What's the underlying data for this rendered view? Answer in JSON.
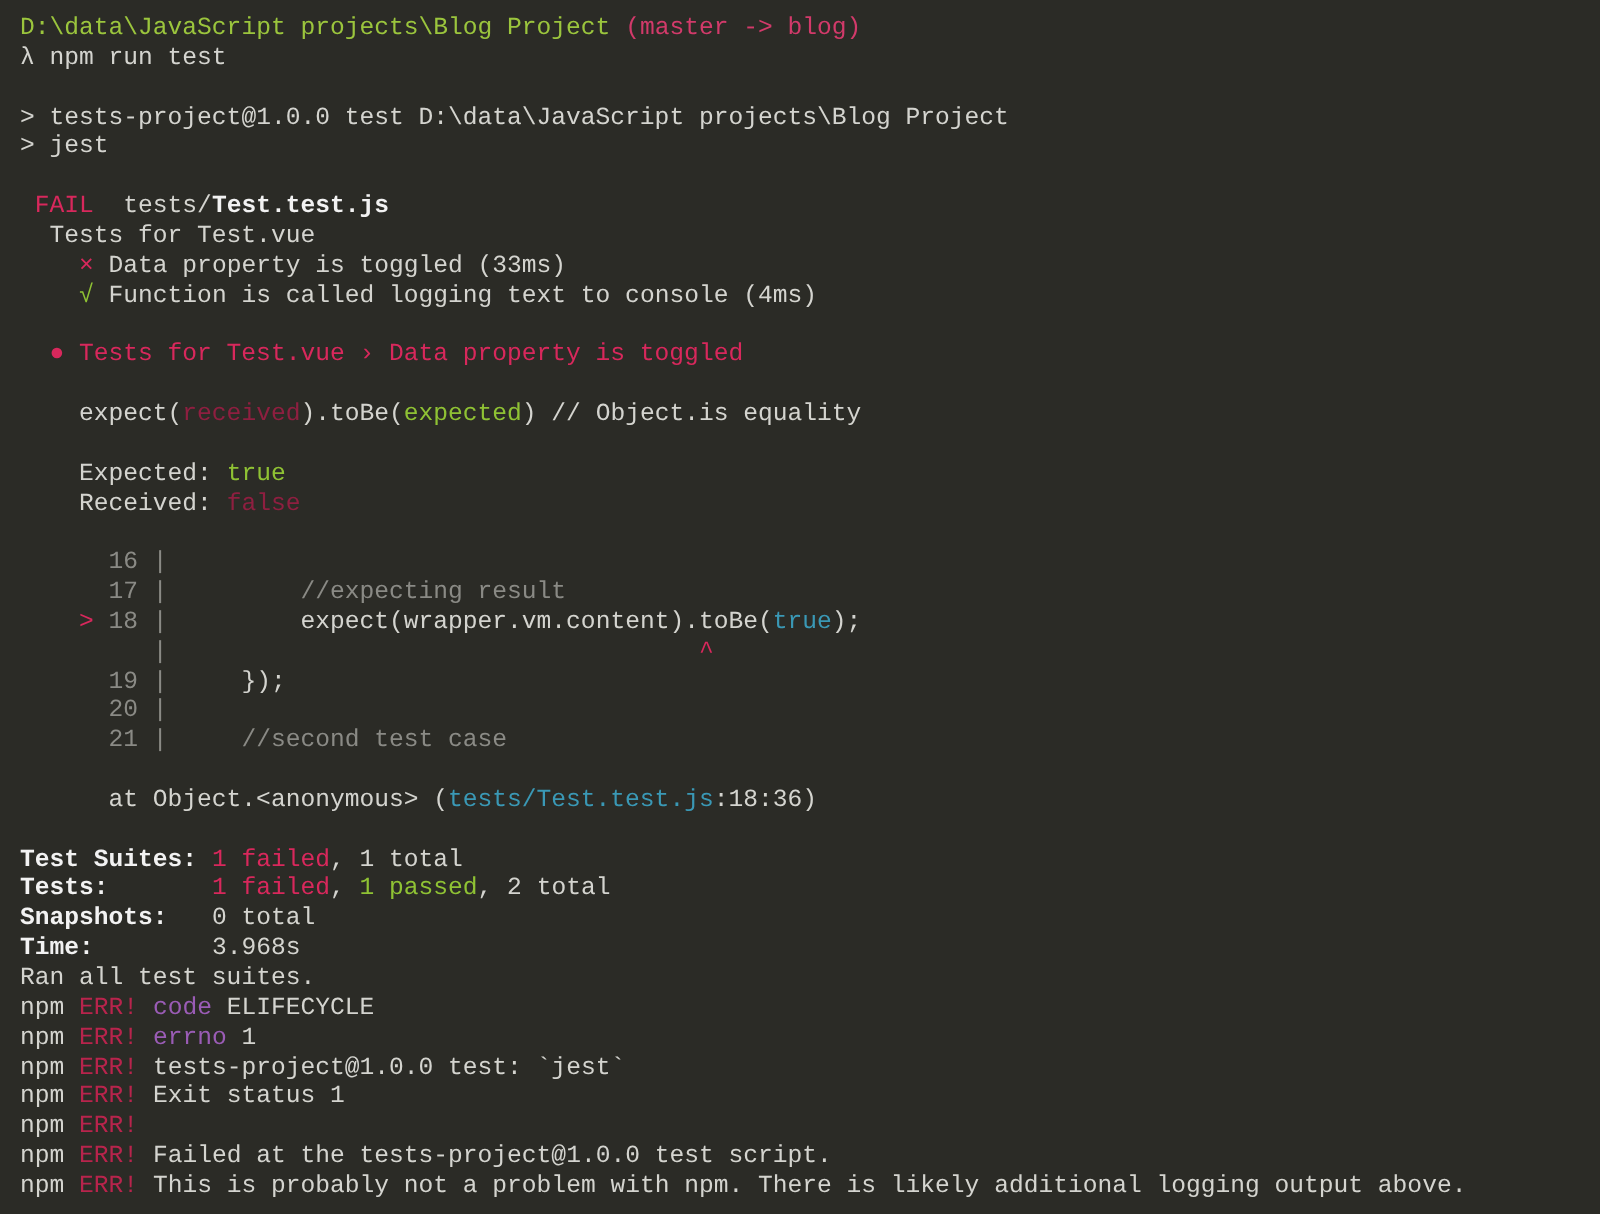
{
  "terminal": {
    "blocks": [
      {
        "lines": [
          {
            "kind": "root",
            "segments": [
              {
                "text": "D:\\data\\JavaScript projects\\Blog Project",
                "kind": "path"
              },
              {
                "text": " (master -> blog)",
                "kind": "branch"
              }
            ]
          },
          {
            "kind": "root",
            "segments": [
              {
                "text": "λ npm run test",
                "kind": "plain"
              }
            ]
          }
        ]
      },
      {
        "lines": [
          {
            "kind": "root",
            "segments": [
              {
                "text": "> tests-project@1.0.0 test D:\\data\\JavaScript projects\\Blog Project",
                "kind": "plain"
              }
            ]
          },
          {
            "kind": "root",
            "segments": [
              {
                "text": "> jest",
                "kind": "plain"
              }
            ]
          }
        ]
      },
      {
        "lines": [
          {
            "kind": "file",
            "segments": [
              {
                "text": "FAIL",
                "kind": "fail"
              },
              {
                "text": "  tests/",
                "kind": "plain"
              },
              {
                "text": "Test.test.js",
                "kind": "bold"
              }
            ]
          },
          {
            "kind": "suite",
            "segments": [
              {
                "text": "Tests for Test.vue",
                "kind": "plain"
              }
            ]
          },
          {
            "kind": "case",
            "segments": [
              {
                "text": "×",
                "kind": "fail"
              },
              {
                "text": " Data property is toggled (33ms)",
                "kind": "plain"
              }
            ]
          },
          {
            "kind": "case",
            "segments": [
              {
                "text": "√",
                "kind": "pass"
              },
              {
                "text": " Function is called logging text to console (4ms)",
                "kind": "plain"
              }
            ]
          }
        ]
      },
      {
        "lines": [
          {
            "kind": "suite",
            "segments": [
              {
                "text": "● Tests for Test.vue › Data property is toggled",
                "kind": "fail"
              }
            ]
          }
        ]
      },
      {
        "lines": [
          {
            "kind": "detail",
            "segments": [
              {
                "text": "expect(",
                "kind": "plain"
              },
              {
                "text": "received",
                "kind": "received"
              },
              {
                "text": ").toBe(",
                "kind": "plain"
              },
              {
                "text": "expected",
                "kind": "pass"
              },
              {
                "text": ") // Object.is equality",
                "kind": "plain"
              }
            ]
          }
        ]
      },
      {
        "lines": [
          {
            "kind": "detail",
            "segments": [
              {
                "text": "Expected: ",
                "kind": "plain"
              },
              {
                "text": "true",
                "kind": "pass"
              }
            ]
          },
          {
            "kind": "detail",
            "segments": [
              {
                "text": "Received: ",
                "kind": "plain"
              },
              {
                "text": "false",
                "kind": "received"
              }
            ]
          }
        ]
      },
      {
        "lines": [
          {
            "kind": "code",
            "segments": [
              {
                "text": "  16 |",
                "kind": "dim"
              }
            ]
          },
          {
            "kind": "code",
            "segments": [
              {
                "text": "  17 |",
                "kind": "dim"
              },
              {
                "text": "         //expecting result",
                "kind": "dim"
              }
            ]
          },
          {
            "kind": "code",
            "segments": [
              {
                "text": ">",
                "kind": "fail"
              },
              {
                "text": " 18 |",
                "kind": "dim"
              },
              {
                "text": "         expect(wrapper.vm.content).toBe(",
                "kind": "plain"
              },
              {
                "text": "true",
                "kind": "link"
              },
              {
                "text": ");",
                "kind": "plain"
              }
            ]
          },
          {
            "kind": "code",
            "segments": [
              {
                "text": "     |",
                "kind": "dim"
              },
              {
                "text": "                                    ^",
                "kind": "fail"
              }
            ]
          },
          {
            "kind": "code",
            "segments": [
              {
                "text": "  19 |",
                "kind": "dim"
              },
              {
                "text": "     });",
                "kind": "plain"
              }
            ]
          },
          {
            "kind": "code",
            "segments": [
              {
                "text": "  20 |",
                "kind": "dim"
              }
            ]
          },
          {
            "kind": "code",
            "segments": [
              {
                "text": "  21 |",
                "kind": "dim"
              },
              {
                "text": "     //second test case",
                "kind": "dim"
              }
            ]
          }
        ]
      },
      {
        "lines": [
          {
            "kind": "trace",
            "segments": [
              {
                "text": "at Object.<anonymous> (",
                "kind": "plain"
              },
              {
                "text": "tests/Test.test.js",
                "kind": "link"
              },
              {
                "text": ":18:36)",
                "kind": "plain"
              }
            ]
          }
        ]
      },
      {
        "lines": [
          {
            "kind": "root",
            "segments": [
              {
                "text": "Test Suites: ",
                "kind": "bold"
              },
              {
                "text": "1 failed",
                "kind": "fail"
              },
              {
                "text": ", 1 total",
                "kind": "plain"
              }
            ]
          },
          {
            "kind": "root",
            "segments": [
              {
                "text": "Tests:       ",
                "kind": "bold"
              },
              {
                "text": "1 failed",
                "kind": "fail"
              },
              {
                "text": ", ",
                "kind": "plain"
              },
              {
                "text": "1 passed",
                "kind": "pass"
              },
              {
                "text": ", 2 total",
                "kind": "plain"
              }
            ]
          },
          {
            "kind": "root",
            "segments": [
              {
                "text": "Snapshots:   ",
                "kind": "bold"
              },
              {
                "text": "0 total",
                "kind": "plain"
              }
            ]
          },
          {
            "kind": "root",
            "segments": [
              {
                "text": "Time:        ",
                "kind": "bold"
              },
              {
                "text": "3.968s",
                "kind": "plain"
              }
            ]
          },
          {
            "kind": "root",
            "segments": [
              {
                "text": "Ran all test suites.",
                "kind": "plain"
              }
            ]
          },
          {
            "kind": "root",
            "segments": [
              {
                "text": "npm ",
                "kind": "plain"
              },
              {
                "text": "ERR!",
                "kind": "err"
              },
              {
                "text": " code",
                "kind": "key"
              },
              {
                "text": " ELIFECYCLE",
                "kind": "plain"
              }
            ]
          },
          {
            "kind": "root",
            "segments": [
              {
                "text": "npm ",
                "kind": "plain"
              },
              {
                "text": "ERR!",
                "kind": "err"
              },
              {
                "text": " errno",
                "kind": "key"
              },
              {
                "text": " 1",
                "kind": "plain"
              }
            ]
          },
          {
            "kind": "root",
            "segments": [
              {
                "text": "npm ",
                "kind": "plain"
              },
              {
                "text": "ERR!",
                "kind": "err"
              },
              {
                "text": " tests-project@1.0.0 test: `jest`",
                "kind": "plain"
              }
            ]
          },
          {
            "kind": "root",
            "segments": [
              {
                "text": "npm ",
                "kind": "plain"
              },
              {
                "text": "ERR!",
                "kind": "err"
              },
              {
                "text": " Exit status 1",
                "kind": "plain"
              }
            ]
          },
          {
            "kind": "root",
            "segments": [
              {
                "text": "npm ",
                "kind": "plain"
              },
              {
                "text": "ERR!",
                "kind": "err"
              }
            ]
          },
          {
            "kind": "root",
            "segments": [
              {
                "text": "npm ",
                "kind": "plain"
              },
              {
                "text": "ERR!",
                "kind": "err"
              },
              {
                "text": " Failed at the tests-project@1.0.0 test script.",
                "kind": "plain"
              }
            ]
          },
          {
            "kind": "root",
            "segments": [
              {
                "text": "npm ",
                "kind": "plain"
              },
              {
                "text": "ERR!",
                "kind": "err"
              },
              {
                "text": " This is probably not a problem with npm. There is likely additional logging output above.",
                "kind": "plain"
              }
            ]
          }
        ]
      }
    ]
  }
}
